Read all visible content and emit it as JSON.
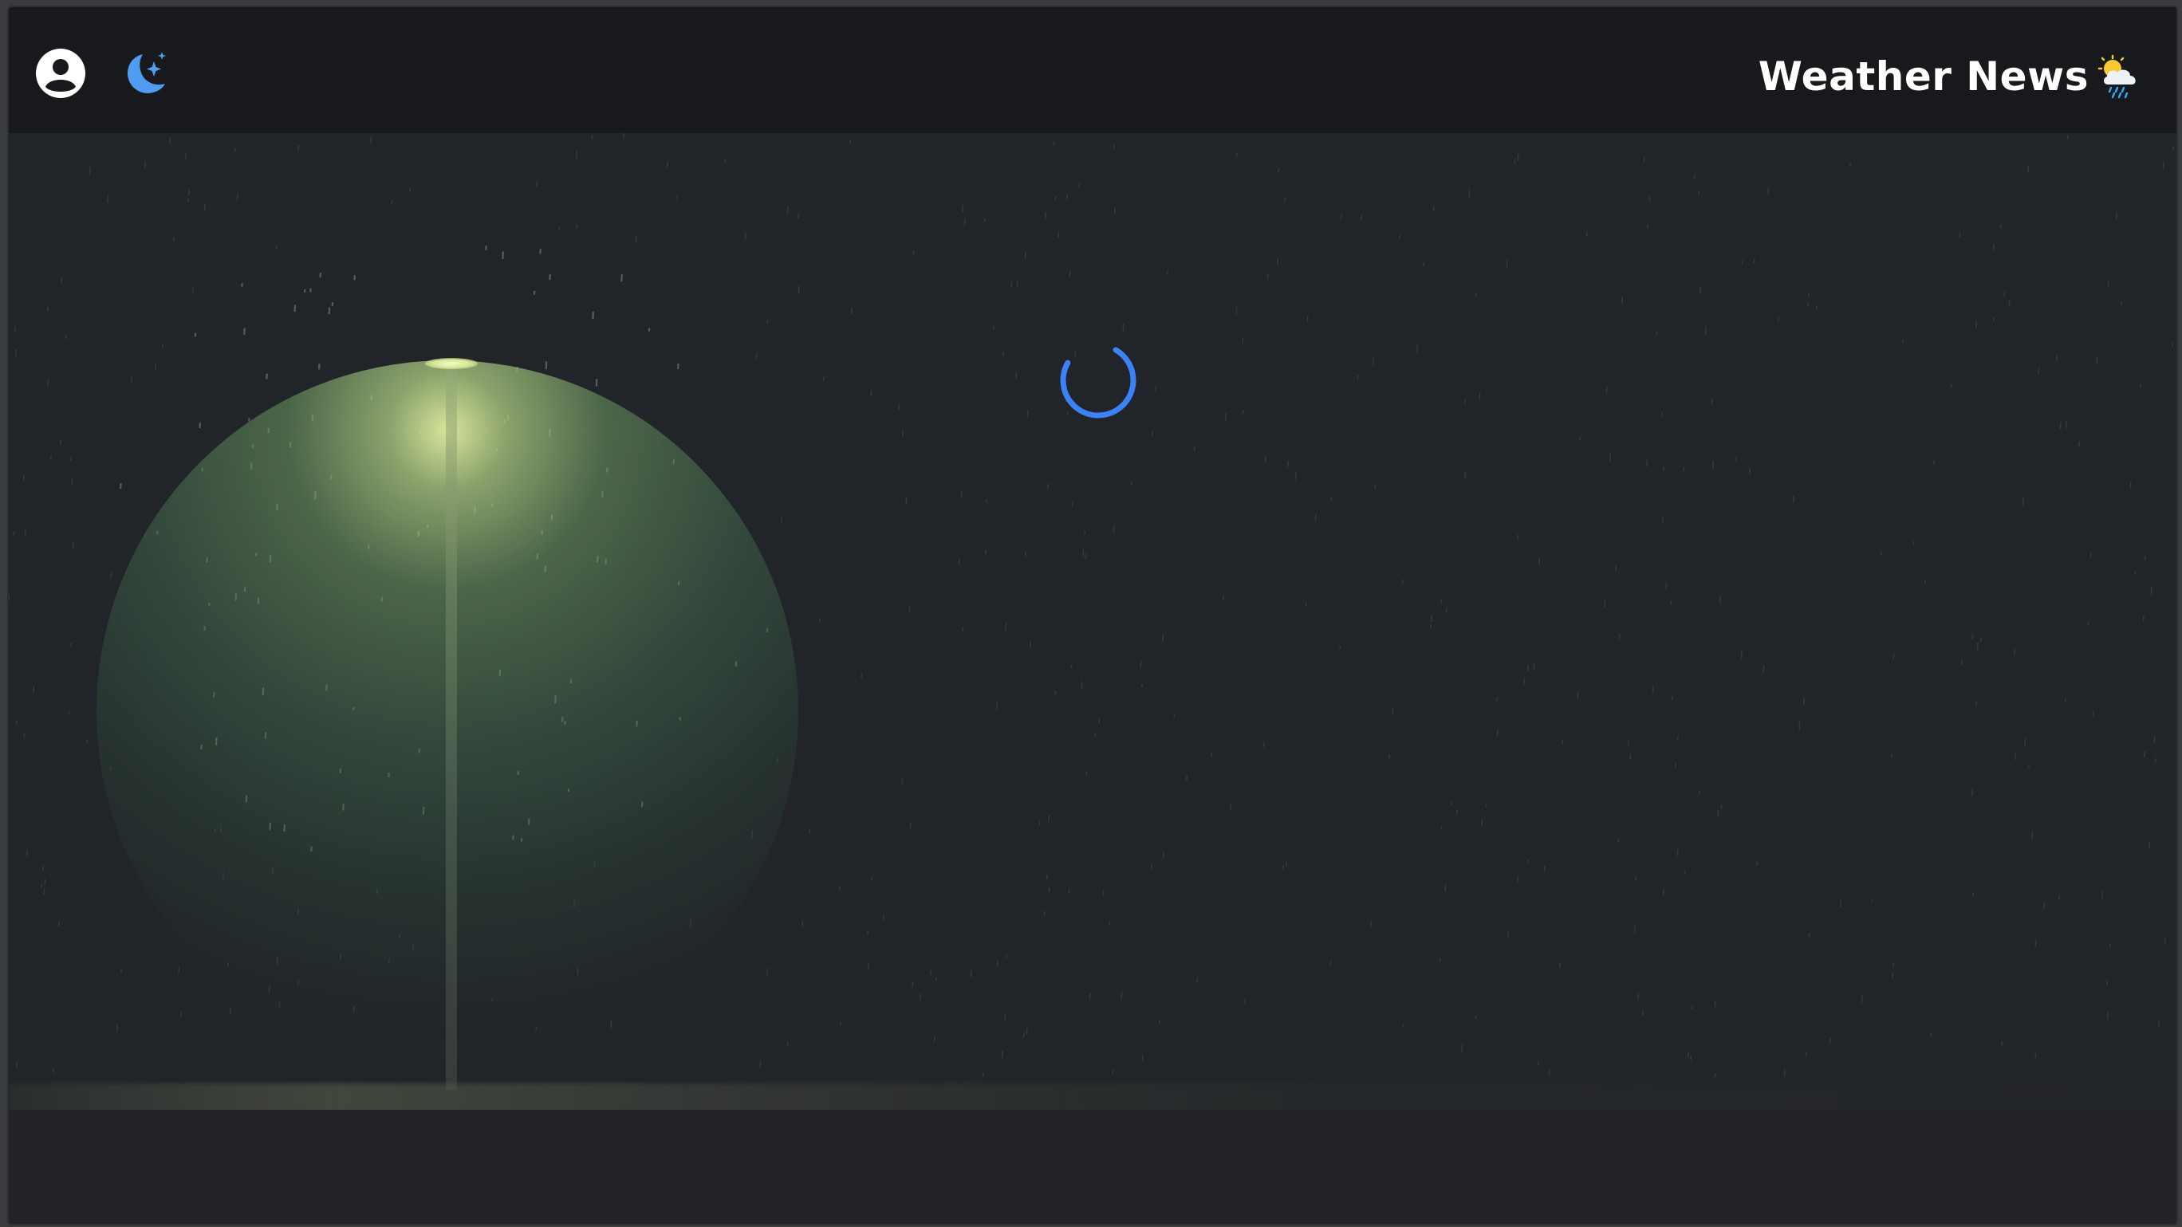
{
  "header": {
    "brand_title": "Weather News",
    "brand_icon": "sun-behind-rain-cloud-icon",
    "user_icon": "user-account-icon",
    "theme_icon": "moon-stars-icon"
  },
  "main": {
    "state": "loading",
    "spinner_icon": "loading-spinner-icon",
    "background_scene": "rainy-night-streetlamp"
  },
  "colors": {
    "topbar_bg": "#17191c",
    "page_bg": "#212428",
    "accent": "#3b82f6",
    "moon_icon": "#4f9cf0",
    "title_text": "#ffffff",
    "lamp_light": "#e6f0a8"
  }
}
